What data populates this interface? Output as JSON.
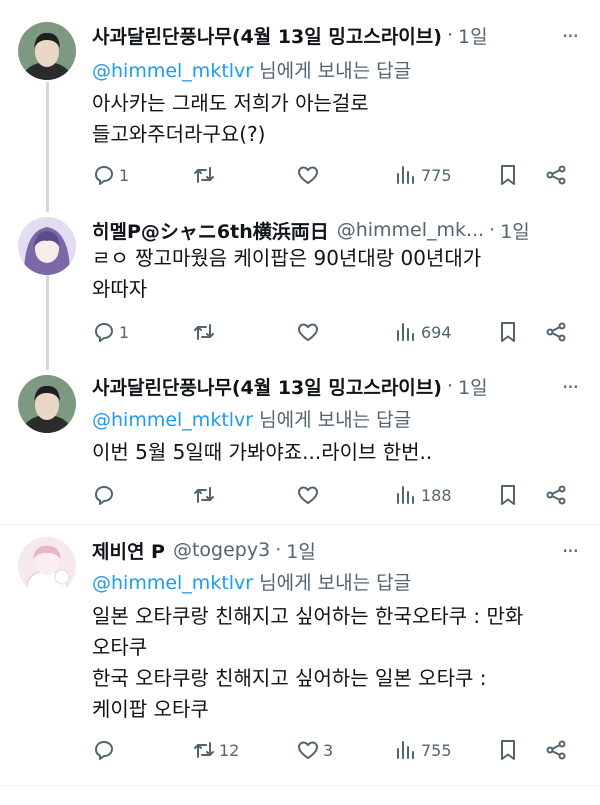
{
  "tweets": [
    {
      "name": "사과달린단풍나무(4월 13일 밍고스라이브)",
      "separator": "·",
      "time": "1일",
      "replying_prefix": "",
      "mention": "@himmel_mktlvr",
      "replying_suffix": " 님에게 보내는 답글",
      "lines": [
        "아사카는 그래도 저희가 아는걸로",
        "들고와주더라구요(?)"
      ],
      "reply_count": "1",
      "retweet_count": "",
      "like_count": "",
      "view_count": "775",
      "avatar_colors": [
        "#6f8a73",
        "#2c2c2c",
        "#e7d7c8"
      ]
    },
    {
      "name": "히멜P@シャニ6th横浜両日",
      "handle": "@himmel_mk...",
      "separator": "·",
      "time": "1일",
      "lines": [
        "ㄹㅇ 짱고마웠음 케이팝은 90년대랑 00년대가",
        "와따자"
      ],
      "reply_count": "1",
      "retweet_count": "",
      "like_count": "",
      "view_count": "694",
      "avatar_colors": [
        "#b9a8d8",
        "#5b4a86",
        "#f0e6f7"
      ]
    },
    {
      "name": "사과달린단풍나무(4월 13일 밍고스라이브)",
      "separator": "·",
      "time": "1일",
      "mention": "@himmel_mktlvr",
      "replying_suffix": " 님에게 보내는 답글",
      "lines": [
        "이번 5월 5일때 가봐야죠...라이브 한번.."
      ],
      "reply_count": "",
      "retweet_count": "",
      "like_count": "",
      "view_count": "188",
      "avatar_colors": [
        "#6f8a73",
        "#2c2c2c",
        "#e7d7c8"
      ]
    },
    {
      "name": "제비연 P",
      "handle": "@togepy3",
      "separator": "·",
      "time": "1일",
      "mention": "@himmel_mktlvr",
      "replying_suffix": " 님에게 보내는 답글",
      "lines": [
        "일본 오타쿠랑 친해지고 싶어하는 한국오타쿠 : 만화",
        "오타쿠",
        "한국 오타쿠랑 친해지고 싶어하는 일본 오타쿠 :",
        "케이팝 오타쿠"
      ],
      "reply_count": "",
      "retweet_count": "12",
      "like_count": "3",
      "view_count": "755",
      "avatar_colors": [
        "#f3dde3",
        "#c98fa0",
        "#ffffff"
      ]
    }
  ],
  "icons": {
    "reply": "reply-icon",
    "retweet": "retweet-icon",
    "like": "heart-icon",
    "views": "views-icon",
    "bookmark": "bookmark-icon",
    "share": "share-icon",
    "more": "more-icon"
  },
  "colors": {
    "text": "#0f1419",
    "secondary": "#536471",
    "link": "#1d9bf0",
    "thread_line": "#cfd9de",
    "divider": "#eff3f4"
  }
}
